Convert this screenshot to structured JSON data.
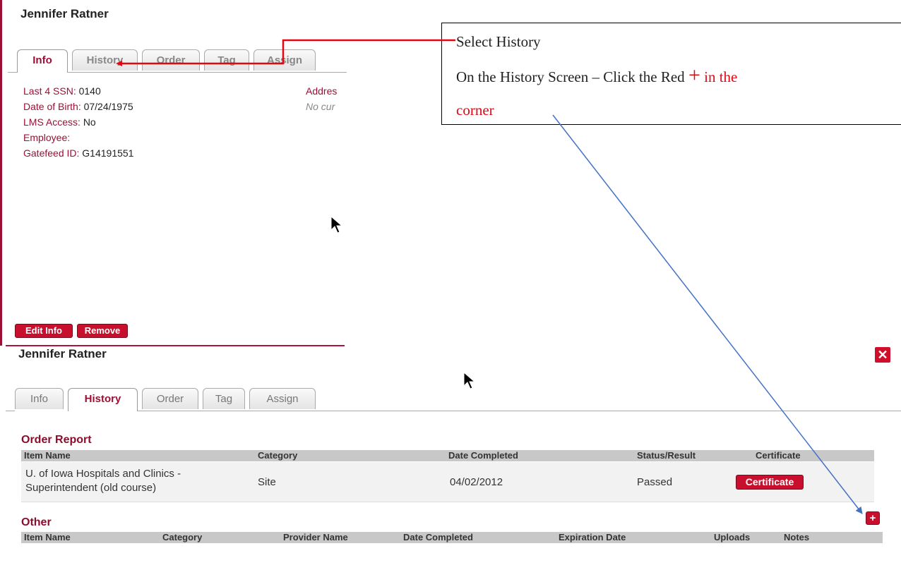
{
  "top": {
    "person_name": "Jennifer Ratner",
    "tabs": [
      "Info",
      "History",
      "Order",
      "Tag",
      "Assign"
    ],
    "active_tab": "Info",
    "fields": [
      {
        "label": "Last 4 SSN:",
        "value": "0140"
      },
      {
        "label": "Date of Birth:",
        "value": "07/24/1975"
      },
      {
        "label": "LMS Access:",
        "value": "No"
      },
      {
        "label": "Employee:",
        "value": ""
      },
      {
        "label": "Gatefeed ID:",
        "value": "G14191551"
      }
    ],
    "address_label": "Addres",
    "address_value": "No cur",
    "edit_button": "Edit Info",
    "remove_button": "Remove"
  },
  "callout": {
    "line1": "Select History",
    "line2_start": "On the History Screen – Click the Red ",
    "plus_symbol": "+",
    "line2_end": " in the",
    "line3": "corner"
  },
  "bottom": {
    "person_name": "Jennifer Ratner",
    "tabs": [
      "Info",
      "History",
      "Order",
      "Tag",
      "Assign"
    ],
    "active_tab": "History",
    "order_report": {
      "title": "Order Report",
      "headers": [
        "Item Name",
        "Category",
        "Date Completed",
        "Status/Result",
        "Certificate"
      ],
      "rows": [
        {
          "item_name_line1": "U. of Iowa Hospitals and Clinics -",
          "item_name_line2": "Superintendent (old course)",
          "category": "Site",
          "date_completed": "04/02/2012",
          "status": "Passed",
          "certificate_button": "Certificate"
        }
      ]
    },
    "other": {
      "title": "Other",
      "headers": [
        "Item Name",
        "Category",
        "Provider Name",
        "Date Completed",
        "Expiration Date",
        "Uploads",
        "Notes"
      ],
      "add_button": "+"
    },
    "close_button": "✕"
  },
  "colors": {
    "brand": "#9c1036",
    "button_red": "#c8102e",
    "arrow_red": "#e30613",
    "arrow_blue": "#4472c4"
  }
}
